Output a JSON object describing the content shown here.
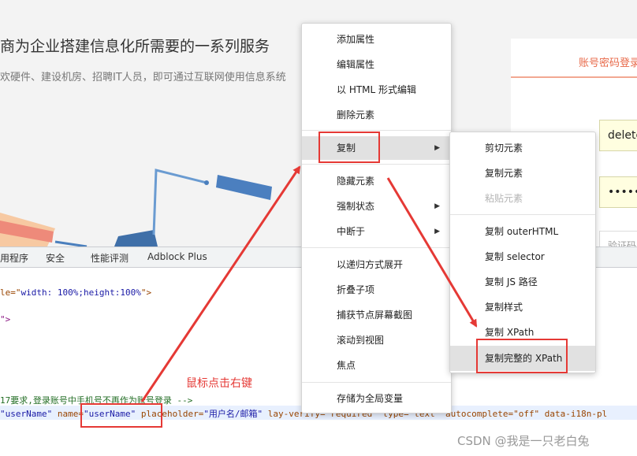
{
  "page": {
    "heading": "商为企业搭建信息化所需要的一系列服务",
    "subheading": "欢硬件、建设机房、招聘IT人员，即可通过互联网使用信息系统"
  },
  "login": {
    "tab_label": "账号密码登录",
    "username_value": "delete",
    "password_value": "••••••",
    "captcha_placeholder": "验证码"
  },
  "devtools": {
    "tabs": [
      "用程序",
      "安全",
      "性能评测",
      "Adblock Plus"
    ],
    "code_lines": {
      "line1_pre": "le=\"",
      "line1_val": "width: 100%;height:100%",
      "line1_post": "\">",
      "line2": "\">",
      "comment": "17要求,登录账号中手机号不再作为账号登录 -->",
      "selected": {
        "id_val": "\"userName\"",
        "name_attr": " name=",
        "name_val": "\"userName\"",
        "ph_attr": " placeholder=",
        "ph_val": "\"用户名/邮箱\"",
        "rest": " lay-verify=\"required\" type=\"text\" autocomplete=\"off\" data-i18n-pl"
      }
    }
  },
  "context_menu": {
    "items": [
      {
        "label": "添加属性"
      },
      {
        "label": "编辑属性"
      },
      {
        "label": "以 HTML 形式编辑"
      },
      {
        "label": "删除元素"
      },
      {
        "label": "复制",
        "submenu": true
      },
      {
        "label": "隐藏元素"
      },
      {
        "label": "强制状态",
        "submenu": true
      },
      {
        "label": "中断于",
        "submenu": true
      },
      {
        "label": "以递归方式展开"
      },
      {
        "label": "折叠子项"
      },
      {
        "label": "捕获节点屏幕截图"
      },
      {
        "label": "滚动到视图"
      },
      {
        "label": "焦点"
      },
      {
        "label": "存储为全局变量"
      }
    ]
  },
  "copy_submenu": {
    "items": [
      {
        "label": "剪切元素"
      },
      {
        "label": "复制元素"
      },
      {
        "label": "粘贴元素",
        "disabled": true
      },
      {
        "label": "复制 outerHTML"
      },
      {
        "label": "复制 selector"
      },
      {
        "label": "复制 JS 路径"
      },
      {
        "label": "复制样式"
      },
      {
        "label": "复制 XPath"
      },
      {
        "label": "复制完整的 XPath"
      }
    ]
  },
  "annotation": "鼠标点击右键",
  "watermark": "CSDN @我是一只老白兔",
  "colors": {
    "accent_red": "#e53935",
    "login_accent": "#e86a4a"
  }
}
